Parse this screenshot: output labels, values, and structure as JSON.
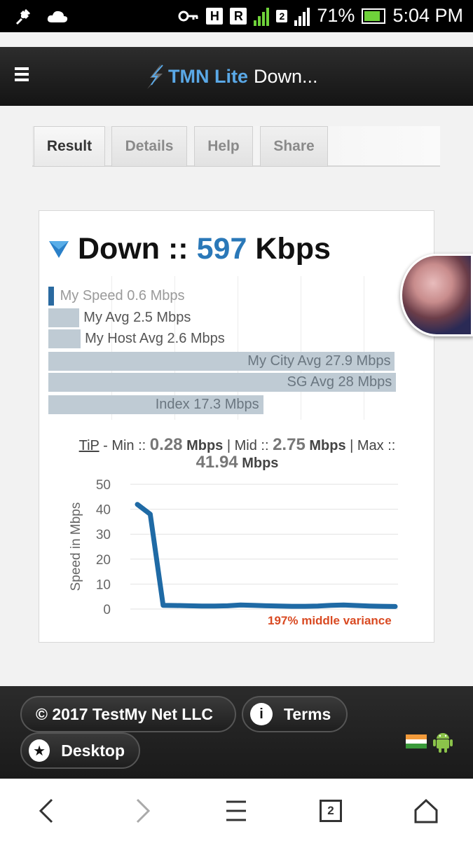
{
  "status_bar": {
    "battery": "71%",
    "time": "5:04 PM",
    "indicators": [
      "H",
      "R",
      "2"
    ],
    "icons": [
      "bug-icon",
      "cloud-icon",
      "key-icon",
      "signal-icon",
      "battery-charging-icon"
    ]
  },
  "header": {
    "brand": "TMN Lite",
    "title": "Down...",
    "menu_icon": "hamburger-icon"
  },
  "tabs": [
    {
      "label": "Result",
      "active": true
    },
    {
      "label": "Details",
      "active": false
    },
    {
      "label": "Help",
      "active": false
    },
    {
      "label": "Share",
      "active": false
    }
  ],
  "result": {
    "direction": "Down ::",
    "value": "597",
    "unit": "Kbps",
    "comparisons": [
      {
        "label": "My Speed 0.6 Mbps",
        "value": 0.6
      },
      {
        "label": "My Avg 2.5 Mbps",
        "value": 2.5
      },
      {
        "label": "My Host Avg 2.6 Mbps",
        "value": 2.6
      },
      {
        "label": "My City Avg 27.9 Mbps",
        "value": 27.9
      },
      {
        "label": "SG Avg 28 Mbps",
        "value": 28
      },
      {
        "label": "Index 17.3 Mbps",
        "value": 17.3
      }
    ],
    "tip": {
      "label": "TiP",
      "min_label": "- Min ::",
      "min": "0.28",
      "mid_label": "| Mid ::",
      "mid": "2.75",
      "max_label": "| Max ::",
      "max": "41.94",
      "unit": "Mbps"
    },
    "variance": "197% middle variance"
  },
  "chart_data": {
    "type": "line",
    "ylabel": "Speed in Mbps",
    "ylim": [
      0,
      50
    ],
    "yticks": [
      "0",
      "10",
      "20",
      "30",
      "40",
      "50"
    ],
    "grid": true,
    "color": "#1f6aa5",
    "x": [
      0,
      1,
      2,
      3,
      4,
      5,
      6,
      7,
      8,
      9,
      10,
      11,
      12,
      13,
      14,
      15,
      16,
      17,
      18,
      19,
      20
    ],
    "values": [
      41.94,
      38.0,
      1.5,
      1.4,
      1.3,
      1.2,
      1.2,
      1.3,
      1.6,
      1.5,
      1.3,
      1.2,
      1.1,
      1.1,
      1.2,
      1.5,
      1.6,
      1.4,
      1.2,
      1.1,
      1.0
    ]
  },
  "footer": {
    "copyright": "© 2017 TestMy Net LLC",
    "terms": "Terms",
    "desktop": "Desktop",
    "icons": [
      "info-icon",
      "star-icon",
      "india-flag-icon",
      "android-icon"
    ]
  },
  "navbar": {
    "tab_count": "2",
    "icons": [
      "back-icon",
      "forward-icon",
      "menu-icon",
      "tabs-icon",
      "home-icon"
    ]
  }
}
